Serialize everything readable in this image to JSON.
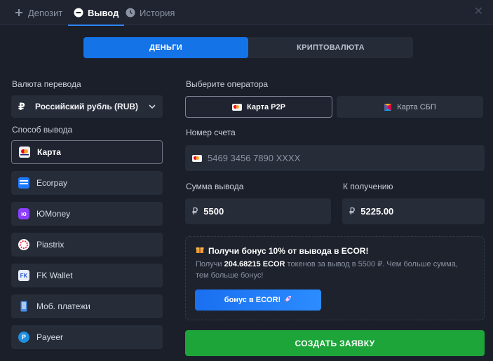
{
  "tabs": [
    {
      "label": "Депозит",
      "icon": "plus-icon"
    },
    {
      "label": "Вывод",
      "icon": "minus-circle-icon",
      "active": true
    },
    {
      "label": "История",
      "icon": "clock-icon"
    }
  ],
  "mode": {
    "money": "ДЕНЬГИ",
    "crypto": "КРИПТОВАЛЮТА",
    "active": "money"
  },
  "currency": {
    "label": "Валюта перевода",
    "value": "Российский рубль (RUB)",
    "icon_symbol": "₽"
  },
  "methods": {
    "label": "Способ вывода",
    "items": [
      {
        "label": "Карта",
        "icon": "visa-card-icon",
        "active": true
      },
      {
        "label": "Ecorpay",
        "icon": "ecorpay-icon"
      },
      {
        "label": "ЮMoney",
        "icon": "yoomoney-icon"
      },
      {
        "label": "Piastrix",
        "icon": "piastrix-icon"
      },
      {
        "label": "FK Wallet",
        "icon": "fk-wallet-icon"
      },
      {
        "label": "Моб. платежи",
        "icon": "mobile-phone-icon"
      },
      {
        "label": "Payeer",
        "icon": "payeer-icon"
      }
    ]
  },
  "operator": {
    "label": "Выберите оператора",
    "options": [
      {
        "label": "Карта P2P",
        "icon": "visa-card-icon",
        "active": true
      },
      {
        "label": "Карта СБП",
        "icon": "sbp-icon"
      }
    ]
  },
  "account": {
    "label": "Номер счета",
    "placeholder": "5469 3456 7890 XXXX"
  },
  "amount": {
    "label": "Сумма вывода",
    "currency_symbol": "₽",
    "value": "5500"
  },
  "receive": {
    "label": "К получению",
    "currency_symbol": "₽",
    "value": "5225.00"
  },
  "bonus": {
    "title": "Получи бонус 10% от вывода в ECOR!",
    "text_prefix": "Получи",
    "text_amount": "204.68215 ECOR",
    "text_suffix": "токенов за вывод в 5500 ₽. Чем больше сумма, тем больше бонус!",
    "button": "бонус в ECOR!"
  },
  "submit": "СОЗДАТЬ ЗАЯВКУ",
  "colors": {
    "accent": "#1473e6",
    "success": "#1ea53a",
    "background": "#1b1f2a"
  }
}
